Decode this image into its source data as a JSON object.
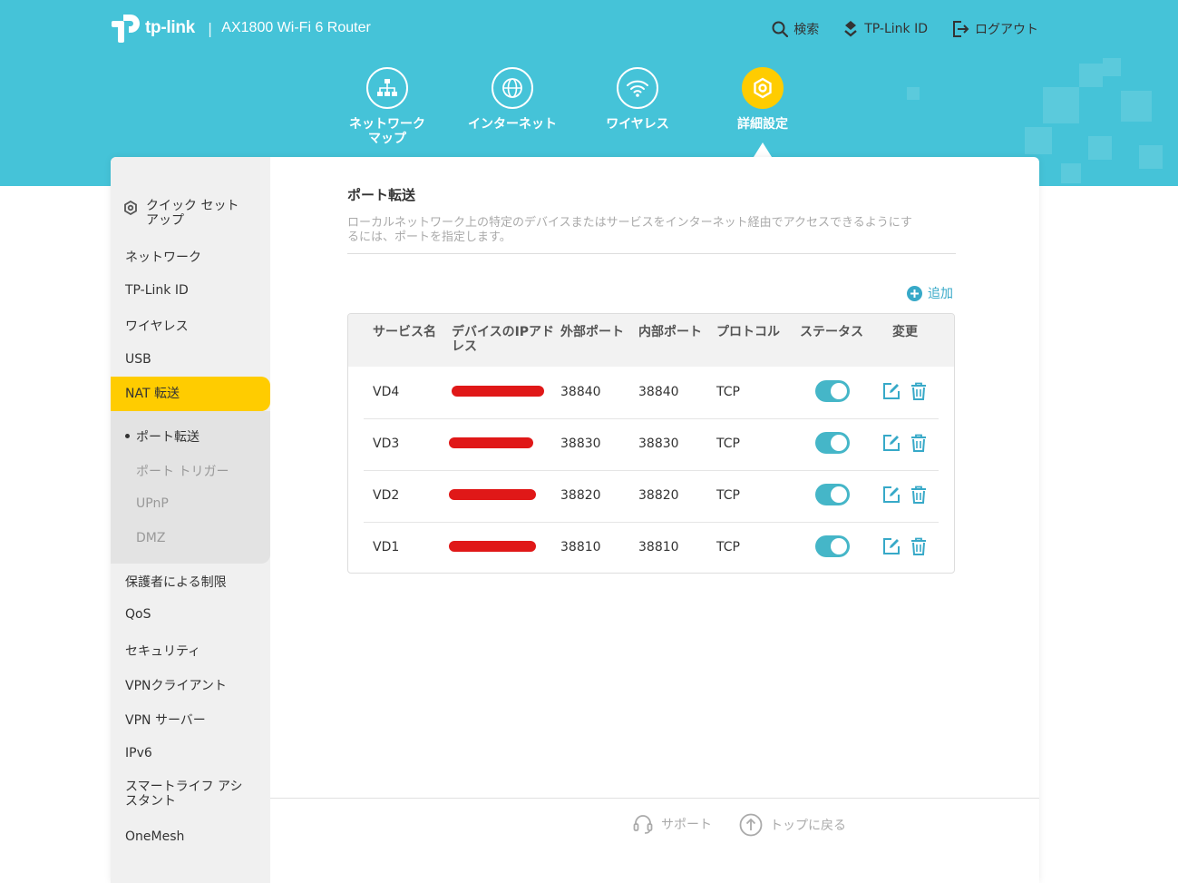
{
  "brand": {
    "logo_text": "tp-link",
    "separator": "|",
    "model": "AX1800 Wi-Fi 6 Router"
  },
  "top_actions": {
    "search": "検索",
    "tplink_id": "TP-Link ID",
    "logout": "ログアウト"
  },
  "nav": {
    "network_map_1": "ネットワーク",
    "network_map_2": "マップ",
    "internet": "インターネット",
    "wireless": "ワイヤレス",
    "advanced": "詳細設定"
  },
  "sidebar": {
    "quick_setup_1": "クイック セット",
    "quick_setup_2": "アップ",
    "network": "ネットワーク",
    "tplink_id": "TP-Link ID",
    "wireless": "ワイヤレス",
    "usb": "USB",
    "nat": "NAT 転送",
    "sub": {
      "port_forwarding": "ポート転送",
      "port_trigger": "ポート トリガー",
      "upnp": "UPnP",
      "dmz": "DMZ"
    },
    "parental": "保護者による制限",
    "qos": "QoS",
    "security": "セキュリティ",
    "vpn_client": "VPNクライアント",
    "vpn_server": "VPN サーバー",
    "ipv6": "IPv6",
    "smart_life_1": "スマートライフ アシ",
    "smart_life_2": "スタント",
    "onemesh": "OneMesh"
  },
  "content": {
    "title": "ポート転送",
    "desc_1": "ローカルネットワーク上の特定のデバイスまたはサービスをインターネット経由でアクセスできるようにす",
    "desc_2": "るには、ポートを指定します。",
    "add_label": "追加"
  },
  "table": {
    "headers": {
      "service": "サービス名",
      "ip_1": "デバイスのIPアド",
      "ip_2": "レス",
      "ext": "外部ポート",
      "int": "内部ポート",
      "proto": "プロトコル",
      "status": "ステータス",
      "modify": "変更"
    },
    "rows": [
      {
        "service": "VD4",
        "ext": "38840",
        "int": "38840",
        "proto": "TCP",
        "enabled": true
      },
      {
        "service": "VD3",
        "ext": "38830",
        "int": "38830",
        "proto": "TCP",
        "enabled": true
      },
      {
        "service": "VD2",
        "ext": "38820",
        "int": "38820",
        "proto": "TCP",
        "enabled": true
      },
      {
        "service": "VD1",
        "ext": "38810",
        "int": "38810",
        "proto": "TCP",
        "enabled": true
      }
    ]
  },
  "footer": {
    "support": "サポート",
    "back_to_top": "トップに戻る"
  },
  "colors": {
    "header_bg": "#45c3d8",
    "accent_yellow": "#ffcc00",
    "toggle_on": "#45b6c8",
    "icon_teal": "#37a9c8",
    "redaction": "#e01818"
  }
}
